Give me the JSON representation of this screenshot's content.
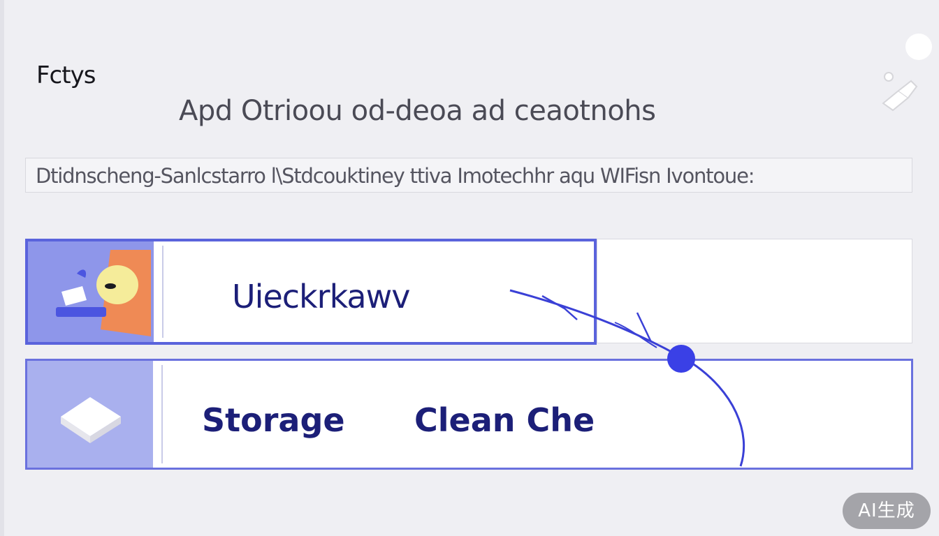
{
  "app": {
    "label": "Fctys"
  },
  "page": {
    "heading": "Apd Otrioou od-deoa ad ceaotnohs",
    "description": "Dtidnscheng-Sanlcstarro l\\Stdcouktiney ttiva Imotechhr aqu WIFisn Ivontoue:"
  },
  "cards": [
    {
      "label": "Uieckrkawv",
      "icon": "tools-icon",
      "selected": true
    },
    {
      "label": "Storage",
      "action": "Clean Che",
      "icon": "eraser-icon",
      "selected": false
    }
  ],
  "badge": {
    "text": "AI生成"
  },
  "colors": {
    "accent": "#5a63dc",
    "card_text": "#1c1f78",
    "icon_panel": "#a9b0ee",
    "background": "#efeff3"
  }
}
